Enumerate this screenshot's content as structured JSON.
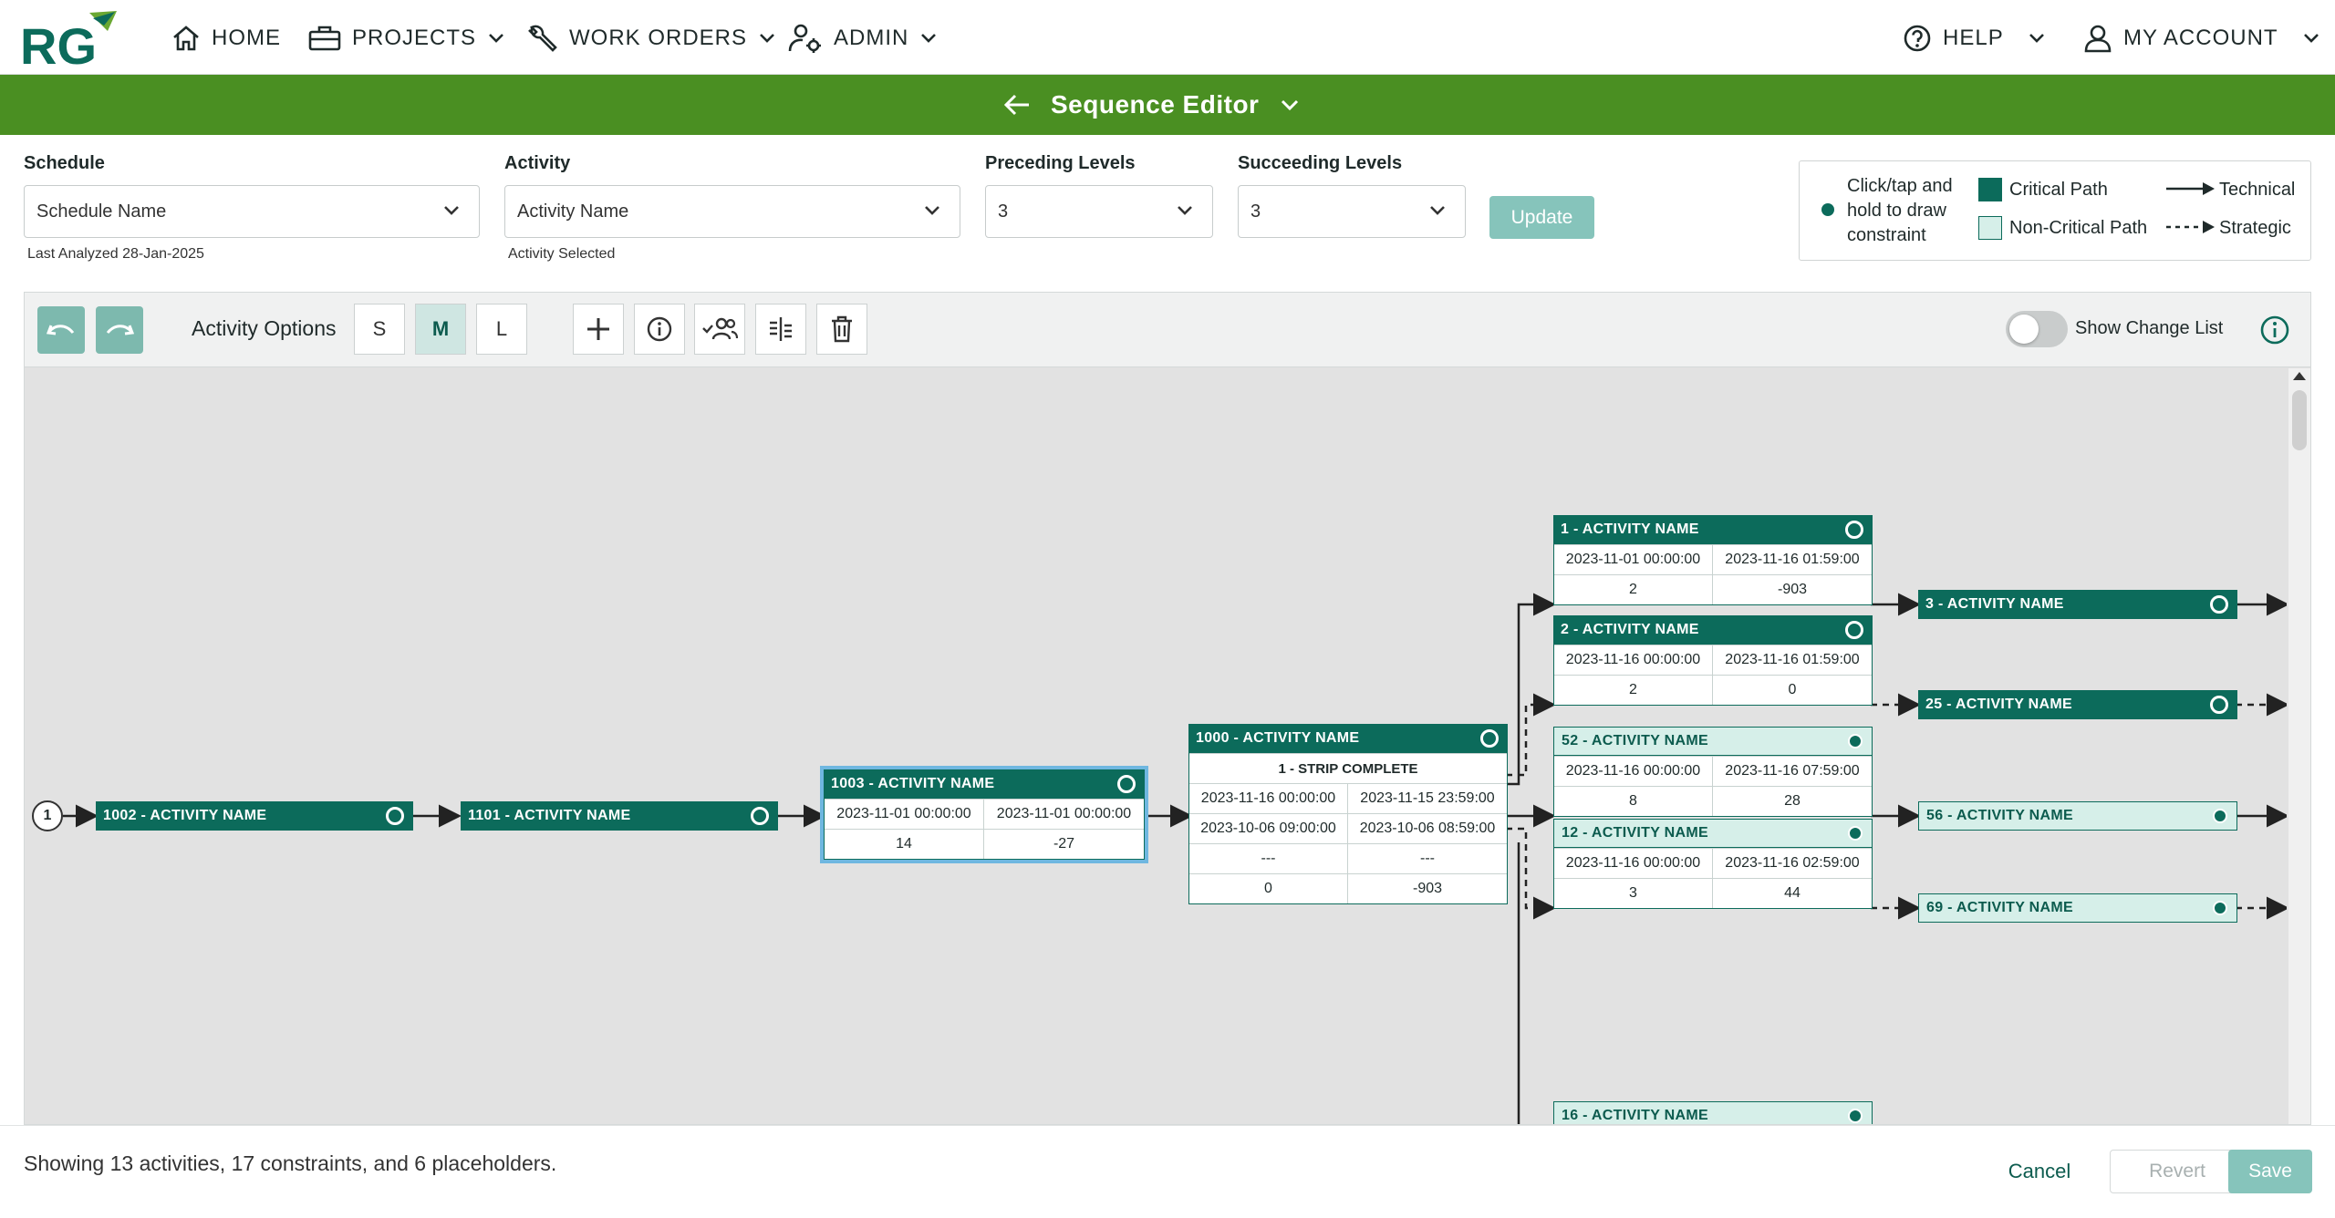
{
  "nav": {
    "home": "HOME",
    "projects": "PROJECTS",
    "work_orders": "WORK ORDERS",
    "admin": "ADMIN",
    "help": "HELP",
    "account": "MY ACCOUNT"
  },
  "title": "Sequence Editor",
  "filters": {
    "schedule_label": "Schedule",
    "schedule_value": "Schedule Name",
    "schedule_note": "Last Analyzed 28-Jan-2025",
    "activity_label": "Activity",
    "activity_value": "Activity Name",
    "activity_note": "Activity Selected",
    "preceding_label": "Preceding Levels",
    "preceding_value": "3",
    "succeeding_label": "Succeeding Levels",
    "succeeding_value": "3",
    "update": "Update"
  },
  "legend": {
    "hint": "Click/tap and hold to draw constraint",
    "critical": "Critical Path",
    "noncritical": "Non-Critical Path",
    "technical": "Technical",
    "strategic": "Strategic",
    "critical_color": "#0c6b5b",
    "noncritical_color": "#d6efe9"
  },
  "toolbar": {
    "activity_options": "Activity Options",
    "size_s": "S",
    "size_m": "M",
    "size_l": "L",
    "active_size": "M",
    "show_change_list": "Show Change List"
  },
  "diagram": {
    "start_label": "1",
    "nodes": {
      "n1002": {
        "title": "1002 - ACTIVITY NAME"
      },
      "n1101": {
        "title": "1101 - ACTIVITY NAME"
      },
      "n1003": {
        "title": "1003 - ACTIVITY NAME",
        "start": "2023-11-01 00:00:00",
        "finish": "2023-11-01 00:00:00",
        "dur": "14",
        "float": "-27"
      },
      "n1000": {
        "title": "1000 - ACTIVITY NAME",
        "sub": "1 - STRIP COMPLETE",
        "r1a": "2023-11-16 00:00:00",
        "r1b": "2023-11-15 23:59:00",
        "r2a": "2023-10-06 09:00:00",
        "r2b": "2023-10-06 08:59:00",
        "r3a": "---",
        "r3b": "---",
        "dur": "0",
        "float": "-903"
      },
      "n1": {
        "title": "1 - ACTIVITY NAME",
        "start": "2023-11-01 00:00:00",
        "finish": "2023-11-16 01:59:00",
        "dur": "2",
        "float": "-903"
      },
      "n2": {
        "title": "2 - ACTIVITY NAME",
        "start": "2023-11-16 00:00:00",
        "finish": "2023-11-16 01:59:00",
        "dur": "2",
        "float": "0"
      },
      "n52": {
        "title": "52 - ACTIVITY NAME",
        "start": "2023-11-16 00:00:00",
        "finish": "2023-11-16 07:59:00",
        "dur": "8",
        "float": "28"
      },
      "n12": {
        "title": "12 - ACTIVITY NAME",
        "start": "2023-11-16 00:00:00",
        "finish": "2023-11-16 02:59:00",
        "dur": "3",
        "float": "44"
      },
      "n16": {
        "title": "16 - ACTIVITY NAME"
      },
      "n3": {
        "title": "3 - ACTIVITY NAME"
      },
      "n25": {
        "title": "25 - ACTIVITY NAME"
      },
      "n56": {
        "title": "56 - ACTIVITY NAME"
      },
      "n69": {
        "title": "69 - ACTIVITY NAME"
      }
    }
  },
  "footer": {
    "summary": "Showing 13 activities, 17 constraints, and 6 placeholders.",
    "cancel": "Cancel",
    "revert": "Revert",
    "save": "Save"
  }
}
